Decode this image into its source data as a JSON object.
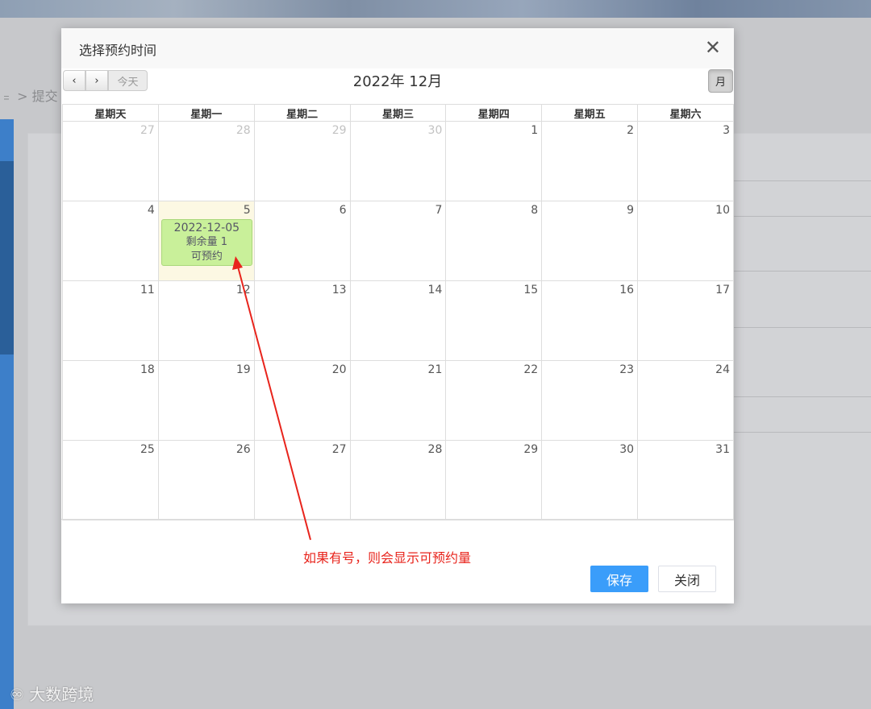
{
  "background": {
    "breadcrumb": "﹦ > 提交",
    "watermark": "大数跨境"
  },
  "dialog": {
    "title": "选择预约时间",
    "close_icon": "close-icon"
  },
  "toolbar": {
    "prev_label": "‹",
    "next_label": "›",
    "today_label": "今天",
    "title": "2022年 12月",
    "month_label": "月"
  },
  "weekdays": [
    "星期天",
    "星期一",
    "星期二",
    "星期三",
    "星期四",
    "星期五",
    "星期六"
  ],
  "weeks": [
    [
      {
        "d": "27",
        "other": true
      },
      {
        "d": "28",
        "other": true
      },
      {
        "d": "29",
        "other": true
      },
      {
        "d": "30",
        "other": true
      },
      {
        "d": "1"
      },
      {
        "d": "2"
      },
      {
        "d": "3"
      }
    ],
    [
      {
        "d": "4"
      },
      {
        "d": "5",
        "today": true
      },
      {
        "d": "6"
      },
      {
        "d": "7"
      },
      {
        "d": "8"
      },
      {
        "d": "9"
      },
      {
        "d": "10"
      }
    ],
    [
      {
        "d": "11"
      },
      {
        "d": "12"
      },
      {
        "d": "13"
      },
      {
        "d": "14"
      },
      {
        "d": "15"
      },
      {
        "d": "16"
      },
      {
        "d": "17"
      }
    ],
    [
      {
        "d": "18"
      },
      {
        "d": "19"
      },
      {
        "d": "20"
      },
      {
        "d": "21"
      },
      {
        "d": "22"
      },
      {
        "d": "23"
      },
      {
        "d": "24"
      }
    ],
    [
      {
        "d": "25"
      },
      {
        "d": "26"
      },
      {
        "d": "27"
      },
      {
        "d": "28"
      },
      {
        "d": "29"
      },
      {
        "d": "30"
      },
      {
        "d": "31"
      }
    ]
  ],
  "event": {
    "date": "2022-12-05",
    "remaining": "剩余量 1",
    "status": "可预约",
    "color": "#c9f09a"
  },
  "annotation": {
    "text": "如果有号，则会显示可预约量",
    "color": "#e8241c"
  },
  "footer": {
    "save_label": "保存",
    "close_label": "关闭",
    "accent": "#3a9dfa"
  }
}
